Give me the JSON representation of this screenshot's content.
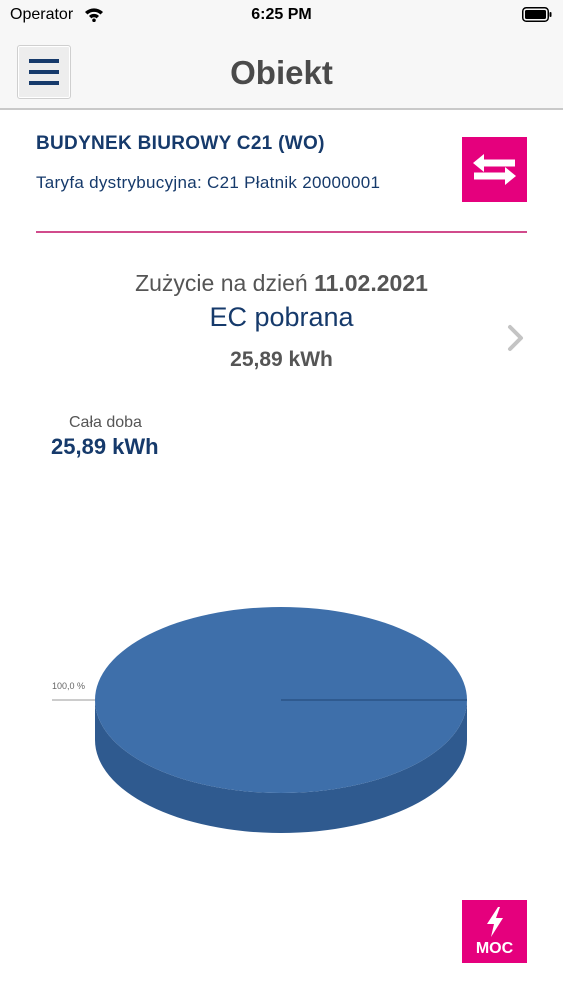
{
  "status_bar": {
    "carrier": "Operator",
    "time": "6:25 PM"
  },
  "nav": {
    "title": "Obiekt",
    "menu_icon": "hamburger-icon"
  },
  "object": {
    "name": "BUDYNEK BIUROWY C21 (WO)",
    "tariff": "Taryfa dystrybucyjna: C21 Płatnik 20000001",
    "switch_icon": "swap-arrows-icon"
  },
  "usage": {
    "date_prefix": "Zużycie na dzień",
    "date": "11.02.2021",
    "type": "EC pobrana",
    "total": "25,89 kWh"
  },
  "zone": {
    "label": "Cała doba",
    "value": "25,89 kWh"
  },
  "chart_data": {
    "type": "pie",
    "slices": [
      {
        "value": 100.0,
        "label": "100,0 %",
        "color": "#3e6faa"
      }
    ]
  },
  "moc_button": {
    "label": "MOC",
    "icon": "lightning-bolt-icon"
  },
  "colors": {
    "accent": "#e5007d",
    "primary_text": "#163a6b",
    "divider": "#d14b8c",
    "pie_top": "#3e6faa",
    "pie_side": "#2f5a8f"
  }
}
